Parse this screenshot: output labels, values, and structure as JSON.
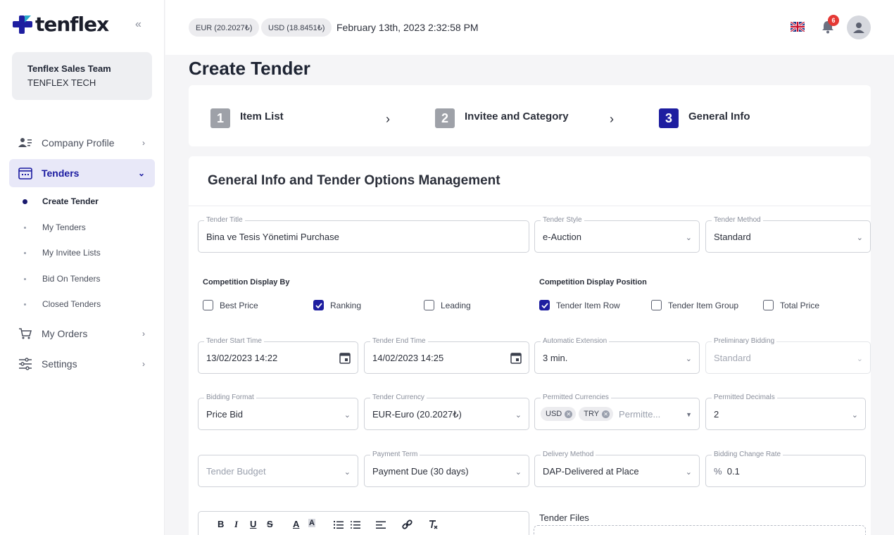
{
  "brand": {
    "name": "tenflex"
  },
  "sidebar": {
    "team_name": "Tenflex Sales Team",
    "team_org": "TENFLEX TECH",
    "items": [
      {
        "label": "Company Profile"
      },
      {
        "label": "Tenders"
      },
      {
        "label": "My Orders"
      },
      {
        "label": "Settings"
      }
    ],
    "sub_items": [
      {
        "label": "Create Tender"
      },
      {
        "label": "My Tenders"
      },
      {
        "label": "My Invitee Lists"
      },
      {
        "label": "Bid On Tenders"
      },
      {
        "label": "Closed Tenders"
      }
    ]
  },
  "header": {
    "eur_rate": "EUR (20.2027₺)",
    "usd_rate": "USD (18.8451₺)",
    "datetime": "February 13th, 2023 2:32:58 PM",
    "notification_count": "6"
  },
  "page": {
    "title": "Create Tender"
  },
  "stepper": {
    "steps": [
      {
        "num": "1",
        "label": "Item List"
      },
      {
        "num": "2",
        "label": "Invitee and Category"
      },
      {
        "num": "3",
        "label": "General Info"
      }
    ]
  },
  "form": {
    "title": "General Info and Tender Options Management",
    "tender_title": {
      "label": "Tender Title",
      "value": "Bina ve Tesis Yönetimi Purchase"
    },
    "tender_style": {
      "label": "Tender Style",
      "value": "e-Auction"
    },
    "tender_method": {
      "label": "Tender Method",
      "value": "Standard"
    },
    "competition_display_by": {
      "label": "Competition Display By",
      "options": [
        "Best Price",
        "Ranking",
        "Leading"
      ]
    },
    "competition_display_position": {
      "label": "Competition Display Position",
      "options": [
        "Tender Item Row",
        "Tender Item Group",
        "Total Price"
      ]
    },
    "start_time": {
      "label": "Tender Start Time",
      "value": "13/02/2023 14:22"
    },
    "end_time": {
      "label": "Tender End Time",
      "value": "14/02/2023 14:25"
    },
    "auto_extension": {
      "label": "Automatic Extension",
      "value": "3 min."
    },
    "preliminary_bidding": {
      "label": "Preliminary Bidding",
      "value": "Standard"
    },
    "bidding_format": {
      "label": "Bidding Format",
      "value": "Price Bid"
    },
    "tender_currency": {
      "label": "Tender Currency",
      "value": "EUR-Euro (20.2027₺)"
    },
    "permitted_currencies": {
      "label": "Permitted Currencies",
      "chips": [
        "USD",
        "TRY"
      ],
      "placeholder": "Permitte..."
    },
    "permitted_decimals": {
      "label": "Permitted Decimals",
      "value": "2"
    },
    "tender_budget": {
      "placeholder": "Tender Budget"
    },
    "payment_term": {
      "label": "Payment Term",
      "value": "Payment Due (30 days)"
    },
    "delivery_method": {
      "label": "Delivery Method",
      "value": "DAP-Delivered at Place"
    },
    "bidding_change_rate": {
      "label": "Bidding Change Rate",
      "prefix": "%",
      "value": "0.1"
    },
    "tender_files_label": "Tender Files",
    "toolbar": {
      "bold": "B",
      "italic": "I",
      "underline": "U",
      "strike": "S",
      "font_color": "A",
      "highlight": "A"
    }
  }
}
